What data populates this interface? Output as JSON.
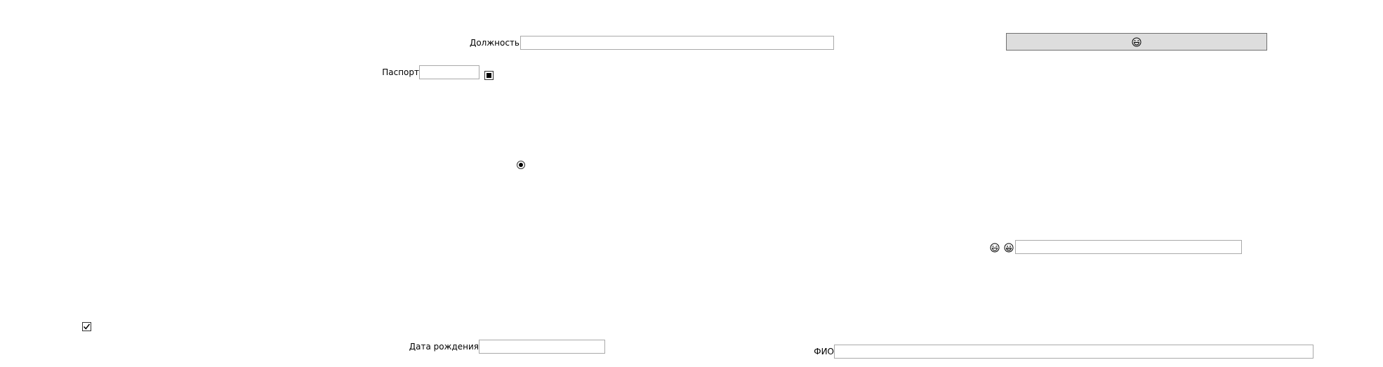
{
  "form": {
    "position_label": "Должность",
    "position_value": "",
    "passport_label": "Паспорт",
    "passport_value": "",
    "birthdate_label": "Дата рождения",
    "birthdate_value": "",
    "fullname_label": "ФИО",
    "fullname_value": "",
    "emoji_field_value": ""
  },
  "controls": {
    "passport_toggle_checked": true,
    "radio_selected": true,
    "checkbox_checked": true
  },
  "icons": {
    "button_icon": "laughing-face-icon",
    "row_icon_1": "laughing-face-icon",
    "row_icon_2": "grinning-face-icon"
  }
}
